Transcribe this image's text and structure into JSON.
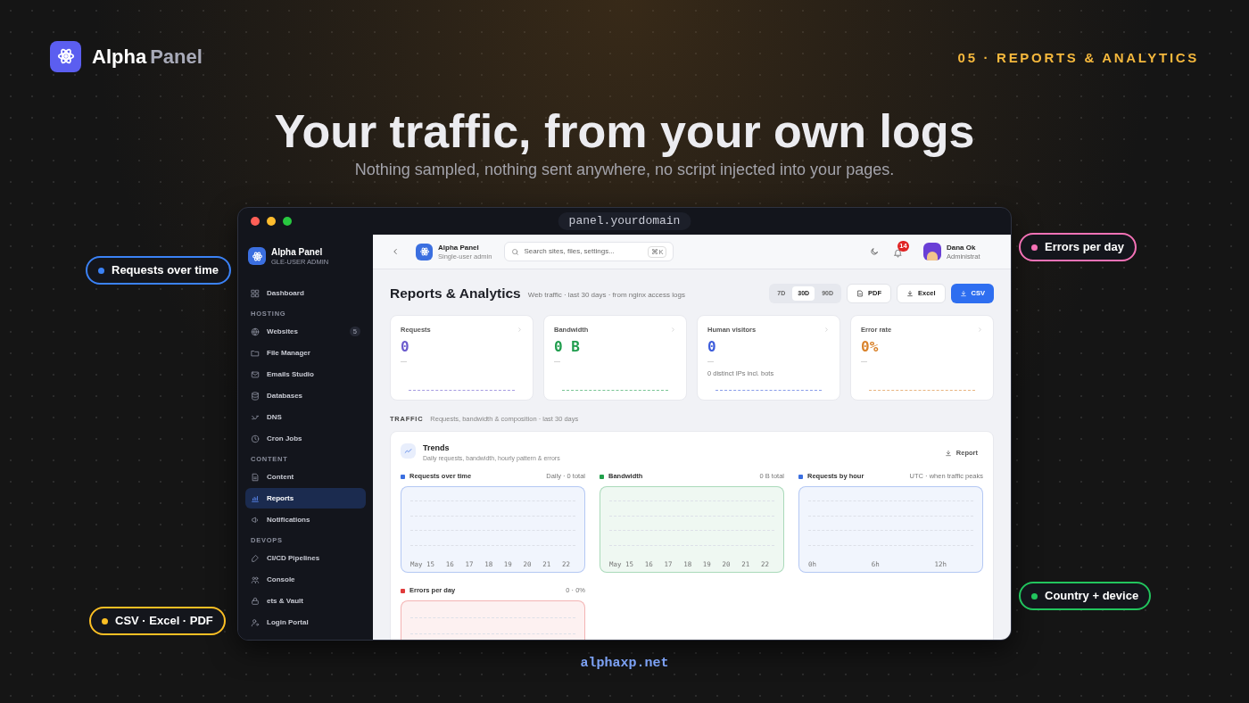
{
  "brand": {
    "name": "Alpha",
    "suffix": "Panel"
  },
  "section_label": "05 · REPORTS & ANALYTICS",
  "headline": "Your traffic, from your own logs",
  "subheadline": "Nothing sampled, nothing sent anywhere, no script injected into your pages.",
  "window": {
    "address": "panel.yourdomain"
  },
  "sidebar": {
    "title": "Alpha Panel",
    "subtitle": "GLE-USER ADMIN",
    "items": [
      {
        "kind": "item",
        "label": "Dashboard",
        "selected": false
      },
      {
        "kind": "section",
        "label": "HOSTING"
      },
      {
        "kind": "item",
        "label": "Websites",
        "selected": false,
        "badge": "5"
      },
      {
        "kind": "item",
        "label": "File Manager",
        "selected": false
      },
      {
        "kind": "item",
        "label": "Emails Studio",
        "selected": false
      },
      {
        "kind": "item",
        "label": "Databases",
        "selected": false
      },
      {
        "kind": "item",
        "label": "DNS",
        "selected": false
      },
      {
        "kind": "item",
        "label": "Cron Jobs",
        "selected": false
      },
      {
        "kind": "section",
        "label": "CONTENT"
      },
      {
        "kind": "item",
        "label": "Content",
        "selected": false
      },
      {
        "kind": "item",
        "label": "Reports",
        "selected": true
      },
      {
        "kind": "item",
        "label": "Notifications",
        "selected": false
      },
      {
        "kind": "section",
        "label": "DEVOPS"
      },
      {
        "kind": "item",
        "label": "CI/CD Pipelines",
        "selected": false
      },
      {
        "kind": "item",
        "label": "Console",
        "selected": false
      },
      {
        "kind": "item",
        "label": "ets & Vault",
        "selected": false
      },
      {
        "kind": "item",
        "label": "Login Portal",
        "selected": false
      }
    ]
  },
  "topbar": {
    "app_name": "Alpha Panel",
    "app_subtitle": "Single-user admin",
    "search_placeholder": "Search sites, files, settings...",
    "shortcut": "⌘K",
    "notification_count": "14",
    "user_name": "Dana Ok",
    "user_role": "Administrat"
  },
  "page": {
    "title": "Reports & Analytics",
    "subtitle": "Web traffic · last 30 days · from nginx access logs",
    "ranges": [
      {
        "label": "7D",
        "selected": false
      },
      {
        "label": "30D",
        "selected": true
      },
      {
        "label": "90D",
        "selected": false
      }
    ],
    "exports": [
      {
        "label": "PDF",
        "kind": "file"
      },
      {
        "label": "Excel",
        "kind": "download"
      },
      {
        "label": "CSV",
        "kind": "primary"
      }
    ]
  },
  "stats": [
    {
      "label": "Requests",
      "value": "0",
      "delta": "—",
      "color": "#6a5acd"
    },
    {
      "label": "Bandwidth",
      "value": "0 B",
      "delta": "—",
      "color": "#1f9d4d"
    },
    {
      "label": "Human visitors",
      "value": "0",
      "delta": "—",
      "note": "0 distinct IPs incl. bots",
      "color": "#3b5bdb"
    },
    {
      "label": "Error rate",
      "value": "0%",
      "delta": "—",
      "color": "#d9822b"
    }
  ],
  "traffic": {
    "label": "TRAFFIC",
    "description": "Requests, bandwidth & composition · last 30 days"
  },
  "trends": {
    "title": "Trends",
    "subtitle": "Daily requests, bandwidth, hourly pattern & errors",
    "report_button": "Report",
    "charts": [
      {
        "title": "Requests over time",
        "meta": "Daily · 0 total",
        "color": "#3b6fe0",
        "x_labels": [
          "May 15",
          "16",
          "17",
          "18",
          "19",
          "20",
          "21",
          "22"
        ]
      },
      {
        "title": "Bandwidth",
        "meta": "0 B total",
        "color": "#22a04b",
        "x_labels": [
          "May 15",
          "16",
          "17",
          "18",
          "19",
          "20",
          "21",
          "22"
        ]
      },
      {
        "title": "Requests by hour",
        "meta": "UTC · when traffic peaks",
        "color": "#3b6fe0",
        "x_labels": [
          "0h",
          "6h",
          "12h"
        ]
      },
      {
        "title": "Errors per day",
        "meta": "0 · 0%",
        "color": "#e03b3b"
      }
    ]
  },
  "callouts": [
    {
      "label": "Requests over time",
      "color": "#3b82f6"
    },
    {
      "label": "Errors per day",
      "color": "#f472b6"
    },
    {
      "label": "Country + device",
      "color": "#22c55e"
    },
    {
      "label": "CSV · Excel · PDF",
      "color": "#fbbf24"
    }
  ],
  "footer": "alphaxp.net"
}
